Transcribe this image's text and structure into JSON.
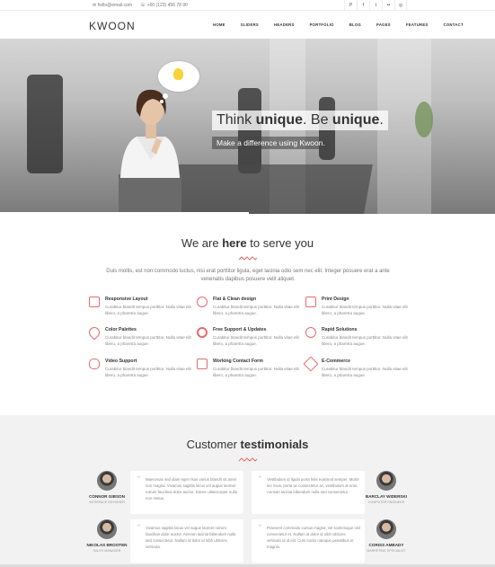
{
  "topbar": {
    "email": "hello@email.com",
    "phone": "+00 (123) 456 78 90",
    "social": [
      "P",
      "f",
      "t",
      "••",
      "◎"
    ]
  },
  "nav": {
    "logo": "KWOON",
    "menu": [
      "HOME",
      "SLIDERS",
      "HEADERS",
      "PORTFOLIO",
      "BLOG",
      "PAGES",
      "FEATURES",
      "CONTACT"
    ]
  },
  "hero": {
    "headline_pre": "Think ",
    "headline_b1": "unique",
    "headline_mid": ". Be ",
    "headline_b2": "unique",
    "headline_end": ".",
    "subline": "Make a difference using Kwoon."
  },
  "serve": {
    "title_pre": "We are ",
    "title_bold": "here",
    "title_post": " to serve you",
    "intro": "Duis mollis, est non commodo luctus, nisi erat porttitor ligula, eget lacinia odio sem nec elit. Integer posuere erat a ante venenatis dapibus posuere velit aliquet.",
    "features": [
      {
        "title": "Responsive Layout",
        "text": "Curabitur blandit tempus porttitor. Nulla vitae elit libero, a pharetra augue.",
        "icon": "layout-icon"
      },
      {
        "title": "Flat & Clean design",
        "text": "Curabitur blandit tempus porttitor. Nulla vitae elit libero, a pharetra augue.",
        "icon": "heart-icon"
      },
      {
        "title": "Print Design",
        "text": "Curabitur blandit tempus porttitor. Nulla vitae elit libero, a pharetra augue.",
        "icon": "printer-icon"
      },
      {
        "title": "Color Palettes",
        "text": "Curabitur blandit tempus porttitor. Nulla vitae elit libero, a pharetra augue.",
        "icon": "drop-icon"
      },
      {
        "title": "Free Support & Updates",
        "text": "Curabitur blandit tempus porttitor. Nulla vitae elit libero, a pharetra augue.",
        "icon": "lifebuoy-icon"
      },
      {
        "title": "Rapid Solutions",
        "text": "Curabitur blandit tempus porttitor. Nulla vitae elit libero, a pharetra augue.",
        "icon": "clock-icon"
      },
      {
        "title": "Video Support",
        "text": "Curabitur blandit tempus porttitor. Nulla vitae elit libero, a pharetra augue.",
        "icon": "video-icon"
      },
      {
        "title": "Working Contact Form",
        "text": "Curabitur blandit tempus porttitor. Nulla vitae elit libero, a pharetra augue.",
        "icon": "form-icon"
      },
      {
        "title": "E-Commerce",
        "text": "Curabitur blandit tempus porttitor. Nulla vitae elit libero, a pharetra augue.",
        "icon": "tag-icon"
      }
    ]
  },
  "testimonials": {
    "title_pre": "Customer ",
    "title_bold": "testimonials",
    "items": [
      {
        "name": "CONNOR GIBSON",
        "role": "INTERFACE DESIGNER",
        "text": "Maecenas sed diam eget risus varius blandit sit amet non magna. Vivamus sagittis lacus vel augue laoreet rutrum faucibus dolor auctor. Donec ullamcorper nulla non metus."
      },
      {
        "name": "BARCLAY WIDERSKI",
        "role": "COMPUTER ENGINEER",
        "text": "Vestibulum id ligula porta felis euismod semper. Morbi leo risus, porta ac consectetur ac, vestibulum at eros. Aenean lacinia bibendum nulla sed consectetur."
      },
      {
        "name": "NIKOLAS BROOTEN",
        "role": "SALES MANAGER",
        "text": "Vivamus sagittis lacus vel augue laoreet rutrum faucibus dolor auctor. Aenean lacinia bibendum nulla sed consectetur. Nullam id dolor id nibh ultricies vehicula."
      },
      {
        "name": "CORISS AMBADY",
        "role": "MARKETING SPECIALIST",
        "text": "Praesent commodo cursus magna, vel scelerisque nisl consectetur et. Nullam id dolor id nibh ultricies vehicula ut id elit. Cum sociis natoque penatibus et magnis."
      }
    ]
  },
  "colors": {
    "accent": "#e76b6b",
    "testimonial_bg": "#f2f2f2"
  }
}
